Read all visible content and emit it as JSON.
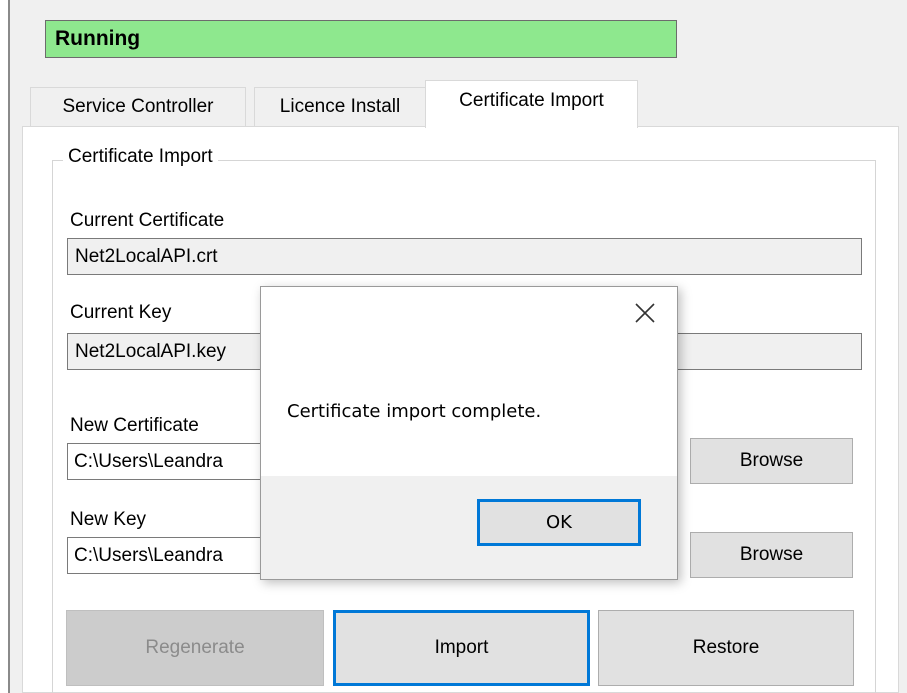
{
  "status": {
    "text": "Running",
    "color": "#8ee88e"
  },
  "tabs": [
    {
      "label": "Service Controller",
      "active": false
    },
    {
      "label": "Licence Install",
      "active": false
    },
    {
      "label": "Certificate Import",
      "active": true
    }
  ],
  "certificate_import": {
    "group_title": "Certificate Import",
    "current_certificate": {
      "label": "Current Certificate",
      "value": "Net2LocalAPI.crt"
    },
    "current_key": {
      "label": "Current Key",
      "value": "Net2LocalAPI.key"
    },
    "new_certificate": {
      "label": "New Certificate",
      "value": "C:\\Users\\Leandra",
      "browse_label": "Browse"
    },
    "new_key": {
      "label": "New Key",
      "value": "C:\\Users\\Leandra",
      "browse_label": "Browse"
    },
    "buttons": {
      "regenerate": "Regenerate",
      "import": "Import",
      "restore": "Restore"
    }
  },
  "dialog": {
    "message": "Certificate import complete.",
    "ok_label": "OK",
    "close_icon": "close-icon"
  },
  "colors": {
    "accent": "#0078d7",
    "status_green": "#8ee88e",
    "window_bg": "#f0f0f0"
  }
}
